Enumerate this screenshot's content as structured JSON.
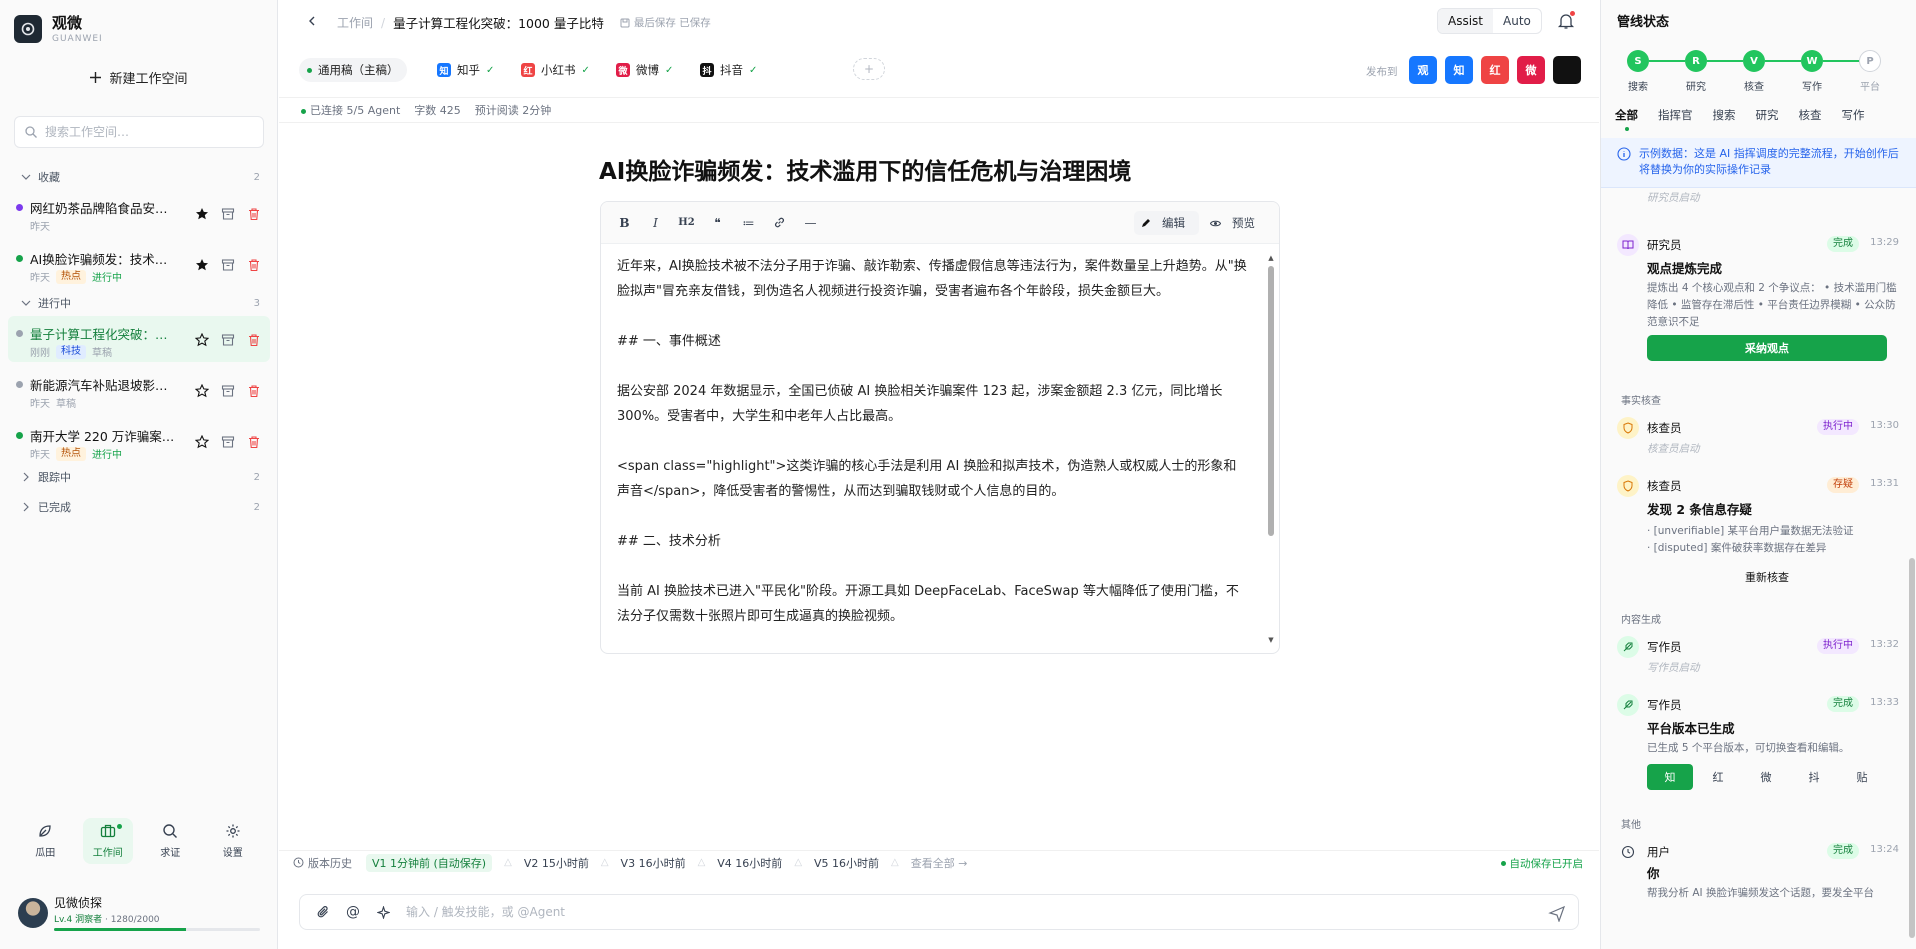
{
  "app": {
    "name": "观微",
    "sub": "GUANWEI"
  },
  "sidebar": {
    "new_workspace": "新建工作空间",
    "search_placeholder": "搜索工作空间…",
    "groups": [
      {
        "label": "收藏",
        "count": "2"
      },
      {
        "label": "进行中",
        "count": "3"
      },
      {
        "label": "跟踪中",
        "count": "2"
      },
      {
        "label": "已完成",
        "count": "2"
      }
    ],
    "items": [
      {
        "title": "网红奶茶品牌陷食品安…",
        "time": "昨天",
        "tag": "",
        "status": "",
        "dot": "#7c3aed"
      },
      {
        "title": "AI换脸诈骗频发：技术…",
        "time": "昨天",
        "tag": "热点",
        "status": "进行中",
        "dot": "#16a34a"
      },
      {
        "title": "量子计算工程化突破：…",
        "time": "刚刚",
        "tag": "科技",
        "status": "草稿",
        "dot": "#9ca3af"
      },
      {
        "title": "新能源汽车补贴退坡影…",
        "time": "昨天",
        "tag": "",
        "status": "草稿",
        "dot": "#9ca3af"
      },
      {
        "title": "南开大学 220 万诈骗案…",
        "time": "昨天",
        "tag": "热点",
        "status": "进行中",
        "dot": "#16a34a"
      }
    ],
    "nav": [
      {
        "label": "瓜田",
        "icon": "leaf-icon"
      },
      {
        "label": "工作间",
        "icon": "briefcase-icon"
      },
      {
        "label": "求证",
        "icon": "search-icon"
      },
      {
        "label": "设置",
        "icon": "gear-icon"
      }
    ],
    "user": {
      "name": "见微侦探",
      "level": "Lv.4 洞察者",
      "xp": "1280/2000",
      "xp_fraction": 0.64
    }
  },
  "topbar": {
    "crumb_root": "工作间",
    "crumb_current": "量子计算工程化突破：1000 量子比特",
    "saved": "最后保存 已保存",
    "modes": [
      "Assist",
      "Auto"
    ]
  },
  "platforms": {
    "tabs": [
      {
        "label": "通用稿（主稿）",
        "icon": "",
        "color": ""
      },
      {
        "label": "知乎",
        "icon": "知",
        "color": "#1677ff"
      },
      {
        "label": "小红书",
        "icon": "红",
        "color": "#ef4444"
      },
      {
        "label": "微博",
        "icon": "微",
        "color": "#e11d48"
      },
      {
        "label": "抖音",
        "icon": "抖",
        "color": "#111111"
      }
    ],
    "add": "+",
    "publish_label": "发布到",
    "publish": [
      {
        "label": "观",
        "color": "#1677ff"
      },
      {
        "label": "知",
        "color": "#1677ff"
      },
      {
        "label": "红",
        "color": "#ef4444"
      },
      {
        "label": "微",
        "color": "#e11d48"
      },
      {
        "label": "",
        "color": "#111111"
      }
    ]
  },
  "status": {
    "agents": "已连接 5/5 Agent",
    "words": "字数 425",
    "reading": "预计阅读 2分钟"
  },
  "doc": {
    "title": "AI换脸诈骗频发：技术滥用下的信任危机与治理困境",
    "toolbar": [
      "B",
      "I",
      "H2",
      "❝",
      "≔",
      "🔗",
      "—"
    ],
    "mode_edit": "编辑",
    "mode_preview": "预览",
    "paragraphs": [
      "近年来，AI换脸技术被不法分子用于诈骗、敲诈勒索、传播虚假信息等违法行为，案件数量呈上升趋势。从\"换脸拟声\"冒充亲友借钱，到伪造名人视频进行投资诈骗，受害者遍布各个年龄段，损失金额巨大。",
      "## 一、事件概述",
      "据公安部 2024 年数据显示，全国已侦破 AI 换脸相关诈骗案件 123 起，涉案金额超 2.3 亿元，同比增长 300%。受害者中，大学生和中老年人占比最高。",
      "<span class=\"highlight\">这类诈骗的核心手法是利用 AI 换脸和拟声技术，伪造熟人或权威人士的形象和声音</span>，降低受害者的警惕性，从而达到骗取钱财或个人信息的目的。",
      "## 二、技术分析",
      "当前 AI 换脸技术已进入\"平民化\"阶段。开源工具如 DeepFaceLab、FaceSwap 等大幅降低了使用门槛，不法分子仅需数十张照片即可生成逼真的换脸视频。"
    ]
  },
  "versions": {
    "label": "版本历史",
    "items": [
      "V1 1分钟前 (自动保存)",
      "V2 15小时前",
      "V3 16小时前",
      "V4 16小时前",
      "V5 16小时前"
    ],
    "all": "查看全部 →",
    "autosave": "自动保存已开启"
  },
  "chat": {
    "placeholder": "输入 / 触发技能，或 @Agent"
  },
  "pipeline": {
    "title": "管线状态",
    "steps": [
      {
        "key": "S",
        "label": "搜索",
        "done": true
      },
      {
        "key": "R",
        "label": "研究",
        "done": true
      },
      {
        "key": "V",
        "label": "核查",
        "done": true
      },
      {
        "key": "W",
        "label": "写作",
        "done": true
      },
      {
        "key": "P",
        "label": "平台",
        "done": false
      }
    ],
    "tabs": [
      "全部",
      "指挥官",
      "搜索",
      "研究",
      "核查",
      "写作"
    ],
    "notice": "示例数据：这是 AI 指挥调度的完整流程，开始创作后将替换为你的实际操作记录",
    "events": {
      "research_start_sub": "研究员启动",
      "researcher": {
        "who": "研究员",
        "badge": "完成",
        "time": "13:29",
        "head": "观点提炼完成",
        "desc": "提炼出 4 个核心观点和 2 个争议点： • 技术滥用门槛降低 • 监管存在滞后性 • 平台责任边界模糊 • 公众防范意识不足",
        "action": "采纳观点"
      },
      "fact_section": "事实核查",
      "checker1": {
        "who": "核查员",
        "badge": "执行中",
        "time": "13:30",
        "sub": "核查员启动"
      },
      "checker2": {
        "who": "核查员",
        "badge": "存疑",
        "time": "13:31",
        "head": "发现 2 条信息存疑",
        "items": [
          "· [unverifiable] 某平台用户量数据无法验证",
          "· [disputed] 案件破获率数据存在差异"
        ],
        "action": "重新核查"
      },
      "gen_section": "内容生成",
      "writer1": {
        "who": "写作员",
        "badge": "执行中",
        "time": "13:32",
        "sub": "写作员启动"
      },
      "writer2": {
        "who": "写作员",
        "badge": "完成",
        "time": "13:33",
        "head": "平台版本已生成",
        "desc": "已生成 5 个平台版本，可切换查看和编辑。",
        "plats": [
          "知",
          "红",
          "微",
          "抖",
          "贴"
        ]
      },
      "other_section": "其他",
      "user": {
        "who": "用户",
        "badge": "完成",
        "time": "13:24",
        "head": "你",
        "desc": "帮我分析 AI 换脸诈骗频发这个话题，要发全平台"
      }
    }
  }
}
